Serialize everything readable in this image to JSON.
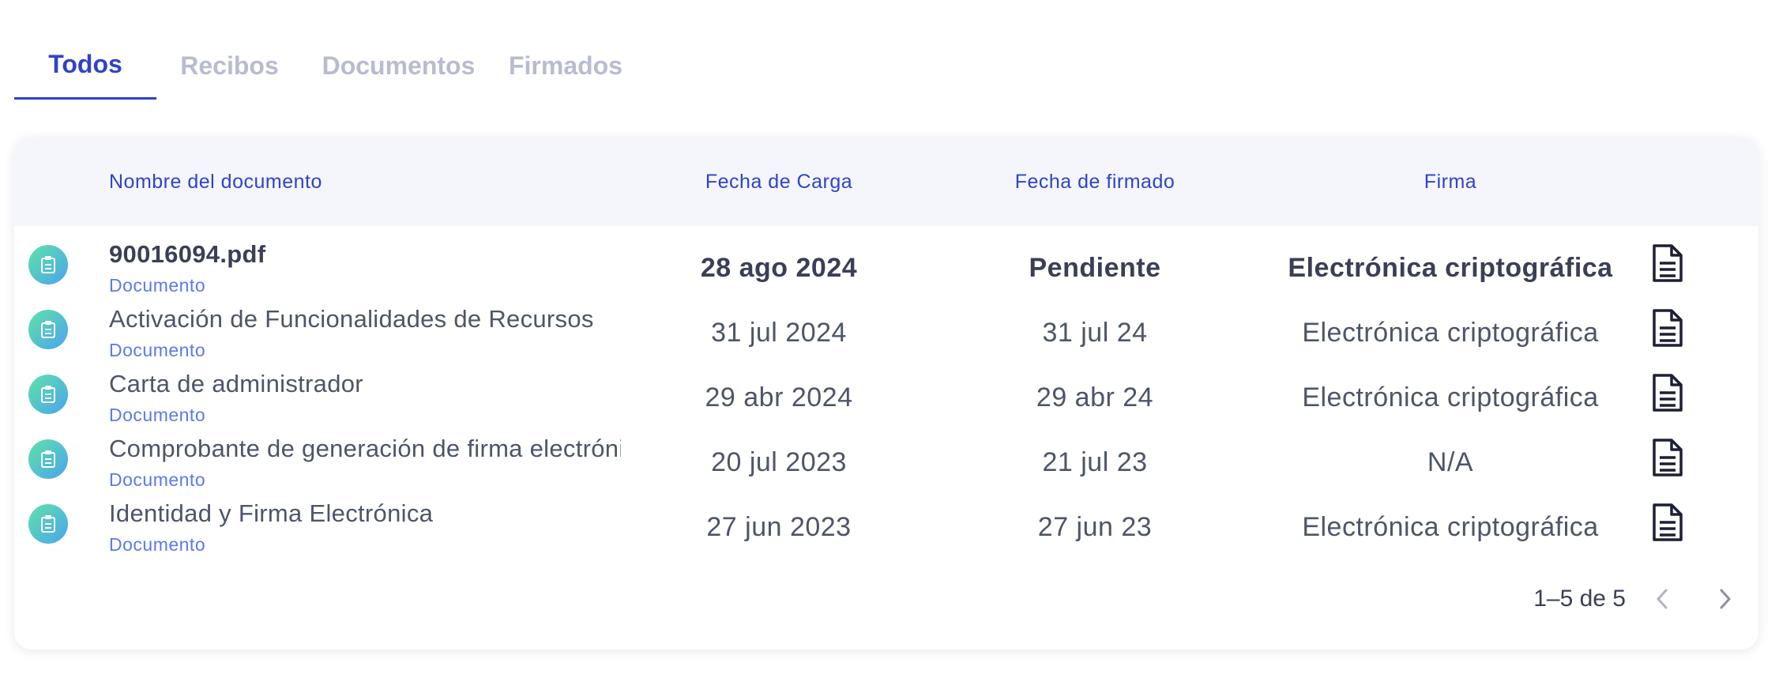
{
  "tabs": [
    {
      "label": "Todos",
      "active": true
    },
    {
      "label": "Recibos",
      "active": false
    },
    {
      "label": "Documentos",
      "active": false
    },
    {
      "label": "Firmados",
      "active": false
    }
  ],
  "table": {
    "headers": {
      "name": "Nombre del documento",
      "upload_date": "Fecha de Carga",
      "signed_date": "Fecha de firmado",
      "signature": "Firma"
    },
    "rows": [
      {
        "name": "90016094.pdf",
        "type": "Documento",
        "upload_date": "28 ago 2024",
        "signed_date": "Pendiente",
        "signature": "Electrónica criptográfica"
      },
      {
        "name": "Activación de Funcionalidades de Recursos",
        "type": "Documento",
        "upload_date": "31 jul 2024",
        "signed_date": "31 jul 24",
        "signature": "Electrónica criptográfica"
      },
      {
        "name": "Carta de administrador",
        "type": "Documento",
        "upload_date": "29 abr 2024",
        "signed_date": "29 abr 24",
        "signature": "Electrónica criptográfica"
      },
      {
        "name": "Comprobante de generación de firma electrónica",
        "type": "Documento",
        "upload_date": "20 jul 2023",
        "signed_date": "21 jul 23",
        "signature": "N/A"
      },
      {
        "name": "Identidad y Firma Electrónica",
        "type": "Documento",
        "upload_date": "27 jun 2023",
        "signed_date": "27 jun 23",
        "signature": "Electrónica criptográfica"
      }
    ],
    "icons": {
      "row": "clipboard-icon",
      "action": "document-icon"
    }
  },
  "pagination": {
    "text": "1–5 de 5",
    "prev_icon": "chevron-left-icon",
    "next_icon": "chevron-right-icon"
  },
  "colors": {
    "accent": "#2f43c9",
    "tab_inactive": "#b9bcd0",
    "link": "#5a7bea",
    "header_bg": "#f5f6fb"
  }
}
